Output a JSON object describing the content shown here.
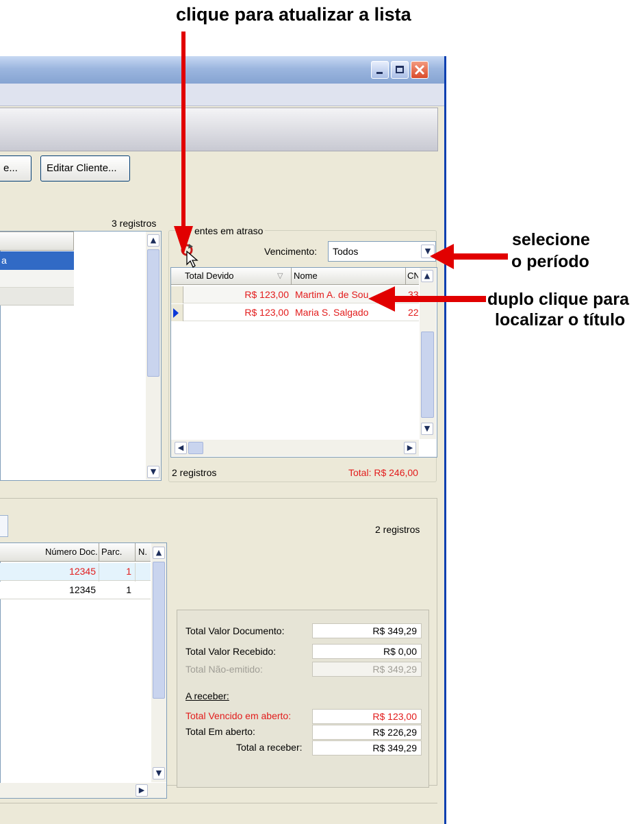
{
  "annotations": {
    "refresh": "clique para atualizar a lista",
    "period_line1": "selecione",
    "period_line2": "o período",
    "dblclick_line1": "duplo clique para",
    "dblclick_line2": "localizar o título"
  },
  "toolbar": {
    "partial_button": "e...",
    "edit_client": "Editar Cliente..."
  },
  "clients": {
    "count": "3 registros",
    "selected_text": "a"
  },
  "overdue": {
    "group_title": "entes em atraso",
    "vencimento_label": "Vencimento:",
    "vencimento_value": "Todos",
    "columns": [
      "Total Devido",
      "Nome",
      "CN"
    ],
    "rows": [
      {
        "total": "R$ 123,00",
        "nome": "Martim A. de Sou",
        "cn": "33"
      },
      {
        "total": "R$ 123,00",
        "nome": "Maria S. Salgado",
        "cn": "22"
      }
    ],
    "count": "2 registros",
    "total": "Total: R$ 246,00"
  },
  "titles": {
    "count": "2 registros",
    "columns": [
      "Número Doc.",
      "Parc.",
      "N."
    ],
    "rows": [
      {
        "doc": "12345",
        "parc": "1"
      },
      {
        "doc": "12345",
        "parc": "1"
      }
    ]
  },
  "summary": {
    "doc_label": "Total Valor Documento:",
    "doc_value": "R$ 349,29",
    "recv_label": "Total Valor Recebido:",
    "recv_value": "R$ 0,00",
    "nonissued_label": "Total Não-emitido:",
    "nonissued_value": "R$ 349,29",
    "receivable_heading": "A receber:",
    "overdue_label": "Total Vencido em aberto:",
    "overdue_value": "R$ 123,00",
    "open_label": "Total Em aberto:",
    "open_value": "R$ 226,29",
    "toreceive_label": "Total a receber:",
    "toreceive_value": "R$ 349,29"
  },
  "colors": {
    "overdue": "#e21b1b",
    "arrow": "#e10000",
    "titlebar": "#9cb6df",
    "window_bg": "#ece9d8"
  }
}
